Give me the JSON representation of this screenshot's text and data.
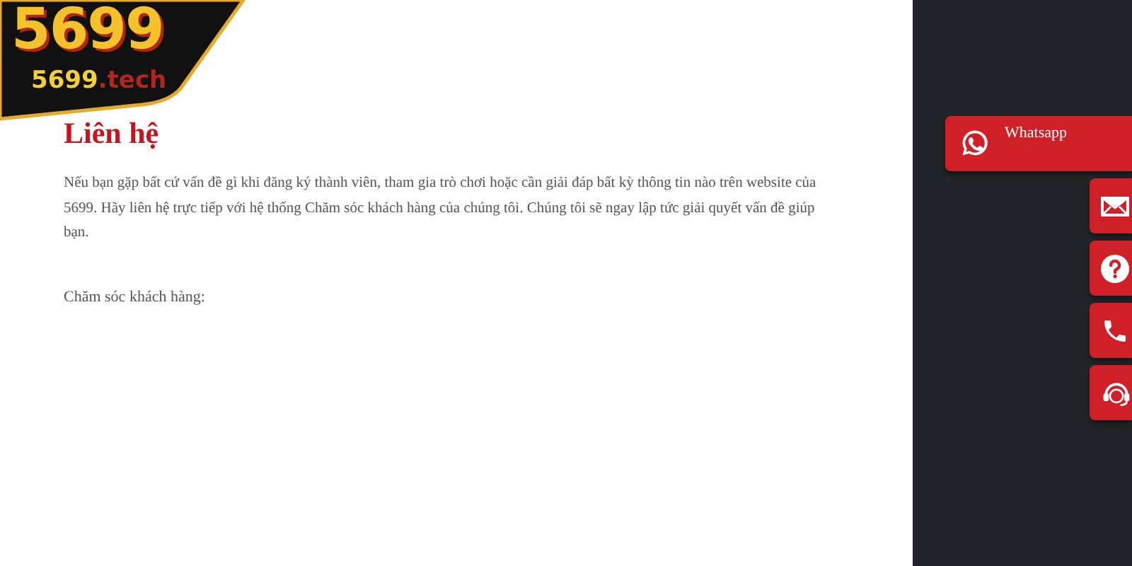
{
  "logo": {
    "number": "5699",
    "domain": "5699",
    "domain_suffix": ".tech"
  },
  "content": {
    "title": "Liên hệ",
    "paragraph": "Nếu bạn gặp bất cứ vấn đề gì khi đăng ký thành viên, tham gia trò chơi hoặc cần giải đáp bất kỳ thông tin nào trên website của 5699. Hãy liên hệ trực tiếp với hệ thống Chăm sóc khách hàng của chúng tôi. Chúng tôi sẽ ngay lập tức giải quyết vấn đề giúp bạn.",
    "label": "Chăm sóc khách hàng:"
  },
  "contact_buttons": [
    {
      "kind": "whatsapp",
      "label": "Whatsapp"
    },
    {
      "kind": "mail"
    },
    {
      "kind": "help"
    },
    {
      "kind": "phone"
    },
    {
      "kind": "support"
    }
  ]
}
